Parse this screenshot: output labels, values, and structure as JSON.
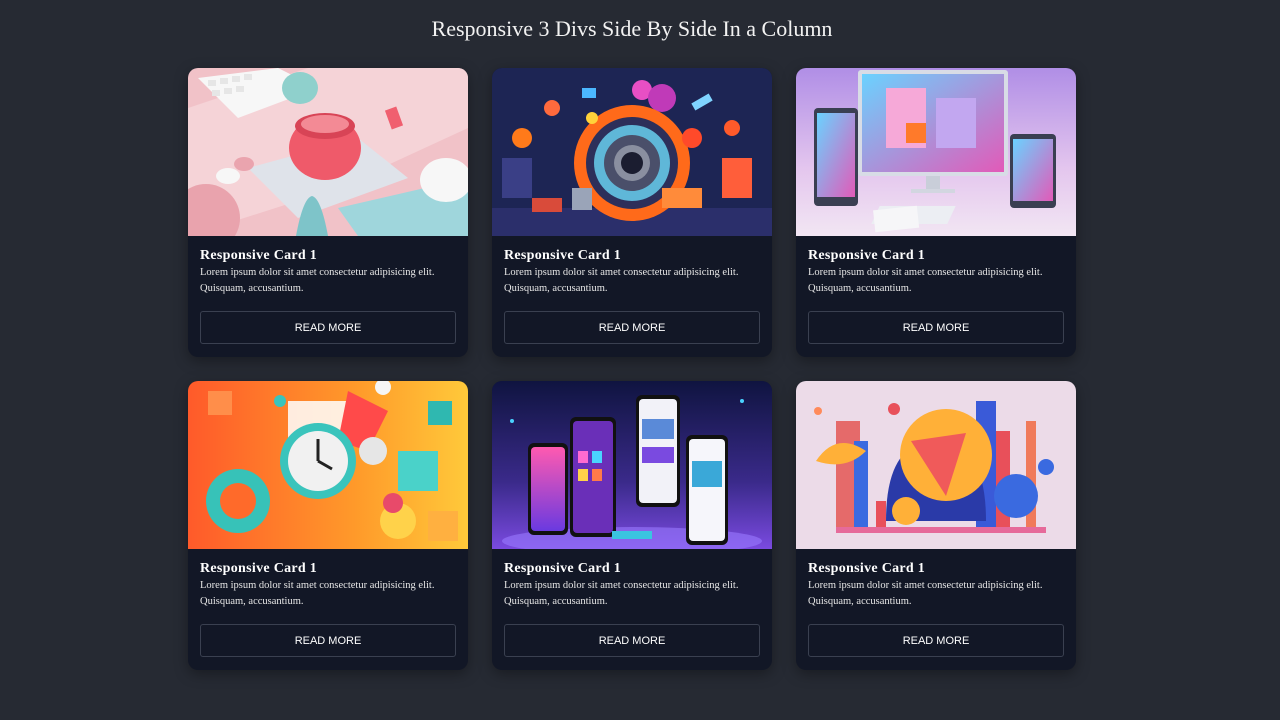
{
  "page": {
    "title": "Responsive 3 Divs Side By Side In a Column"
  },
  "cards": [
    {
      "title": "Responsive Card 1",
      "text": "Lorem ipsum dolor sit amet consectetur adipisicing elit. Quisquam, accusantium.",
      "button": "READ MORE",
      "image": "pink-3d-desk-scene"
    },
    {
      "title": "Responsive Card 1",
      "text": "Lorem ipsum dolor sit amet consectetur adipisicing elit. Quisquam, accusantium.",
      "button": "READ MORE",
      "image": "colorful-gadgets-collage"
    },
    {
      "title": "Responsive Card 1",
      "text": "Lorem ipsum dolor sit amet consectetur adipisicing elit. Quisquam, accusantium.",
      "button": "READ MORE",
      "image": "responsive-devices-mockup"
    },
    {
      "title": "Responsive Card 1",
      "text": "Lorem ipsum dolor sit amet consectetur adipisicing elit. Quisquam, accusantium.",
      "button": "READ MORE",
      "image": "clock-abstract-shapes"
    },
    {
      "title": "Responsive Card 1",
      "text": "Lorem ipsum dolor sit amet consectetur adipisicing elit. Quisquam, accusantium.",
      "button": "READ MORE",
      "image": "mobile-app-phones"
    },
    {
      "title": "Responsive Card 1",
      "text": "Lorem ipsum dolor sit amet consectetur adipisicing elit. Quisquam, accusantium.",
      "button": "READ MORE",
      "image": "abstract-city-sphere"
    }
  ],
  "colors": {
    "background": "#262a33",
    "card": "#121726",
    "button_border": "#3a4050"
  }
}
